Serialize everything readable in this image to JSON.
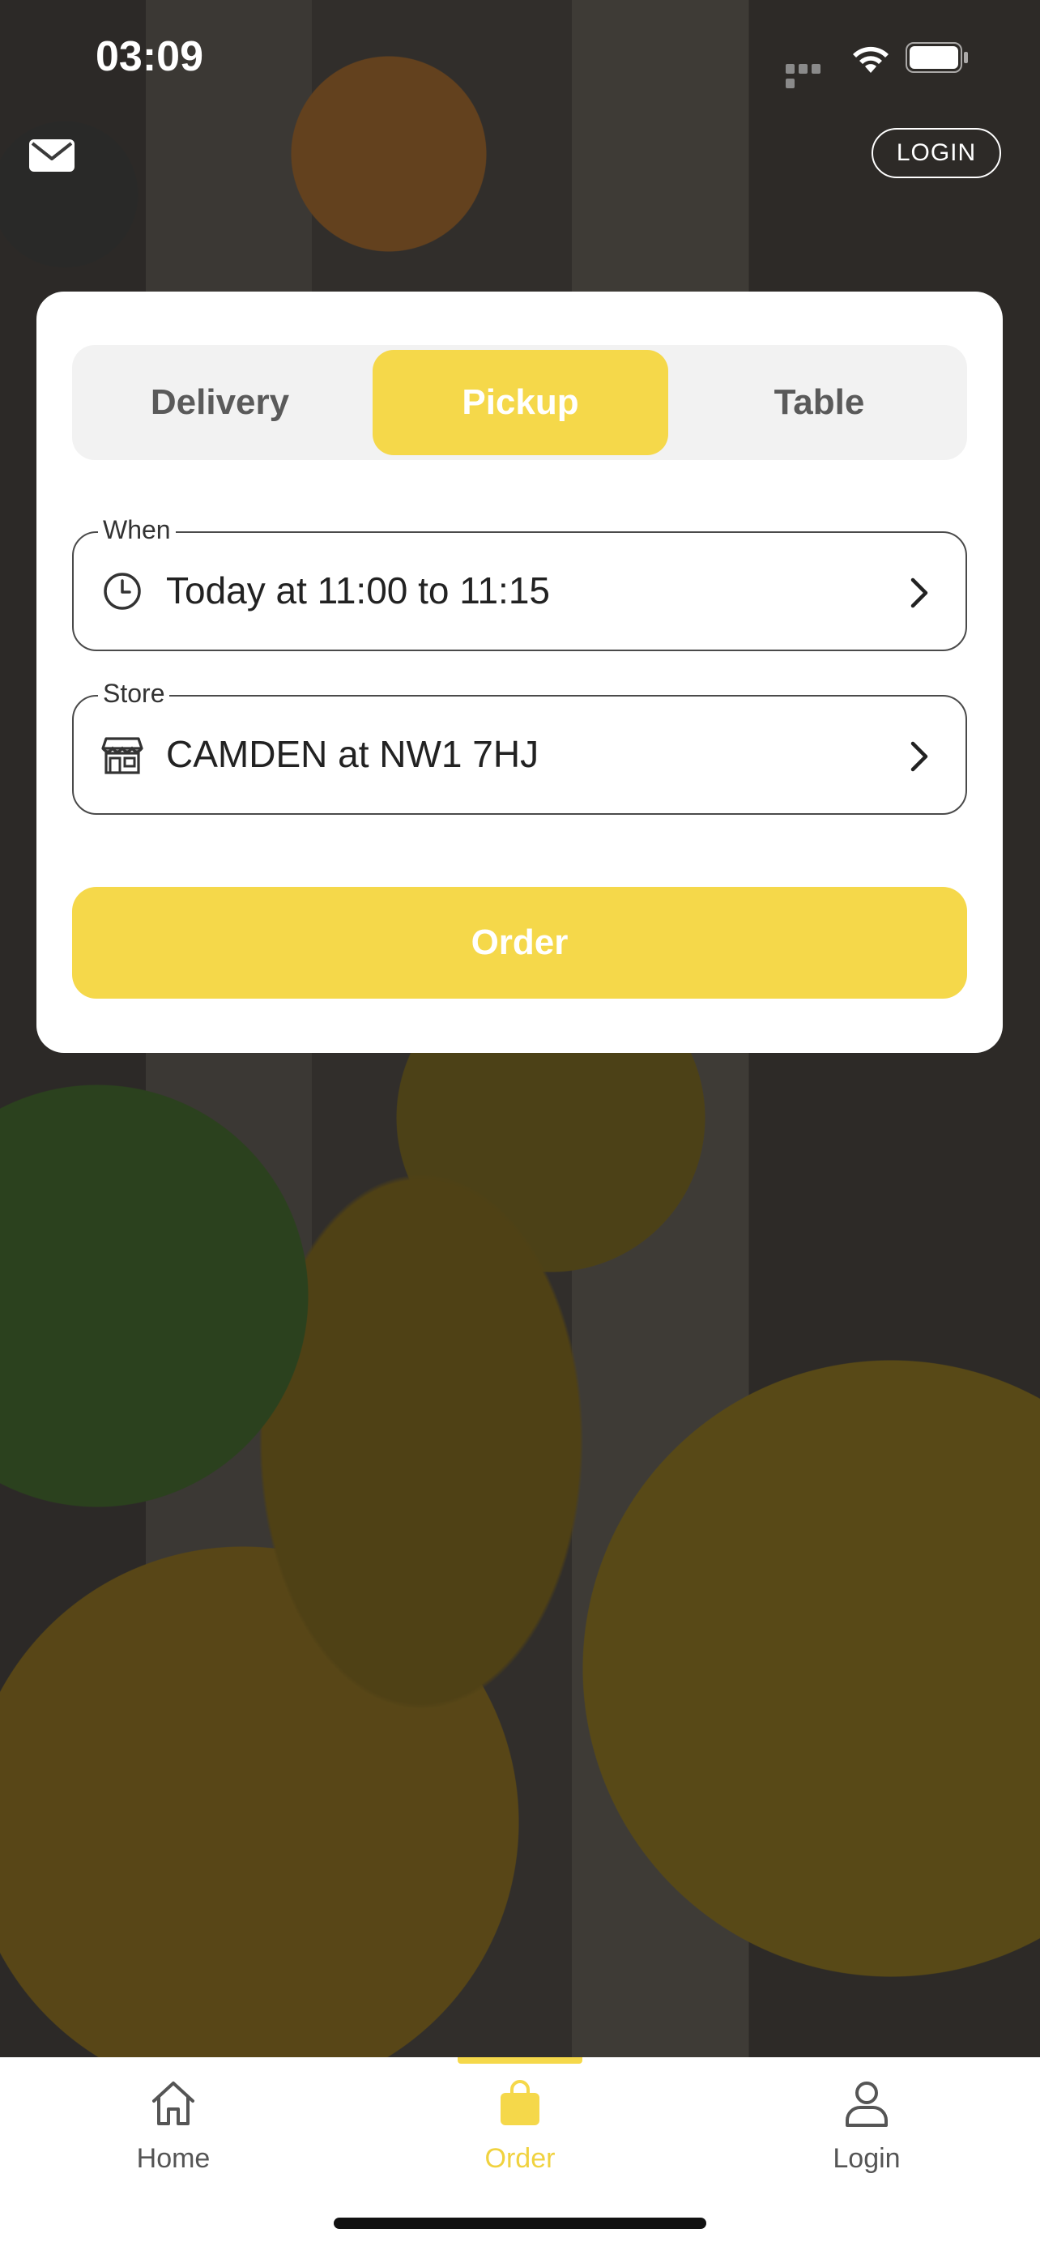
{
  "status_bar": {
    "time": "03:09"
  },
  "header": {
    "login_label": "LOGIN"
  },
  "order_mode": {
    "tabs": [
      {
        "label": "Delivery",
        "selected": false
      },
      {
        "label": "Pickup",
        "selected": true
      },
      {
        "label": "Table",
        "selected": false
      }
    ]
  },
  "when_field": {
    "label": "When",
    "value": "Today at 11:00 to 11:15"
  },
  "store_field": {
    "label": "Store",
    "value": "CAMDEN at NW1 7HJ"
  },
  "order_button": {
    "label": "Order"
  },
  "tab_bar": {
    "items": [
      {
        "label": "Home",
        "icon": "home-icon",
        "active": false
      },
      {
        "label": "Order",
        "icon": "bag-icon",
        "active": true
      },
      {
        "label": "Login",
        "icon": "person-icon",
        "active": false
      }
    ]
  },
  "colors": {
    "accent": "#f5d84a",
    "text": "#222222",
    "segment_bg": "#f2f2f2"
  }
}
